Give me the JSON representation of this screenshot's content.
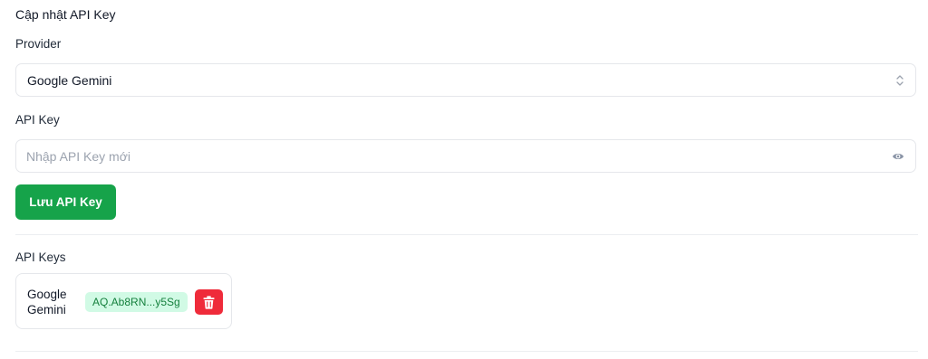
{
  "form": {
    "title": "Cập nhật API Key",
    "provider_label": "Provider",
    "provider_value": "Google Gemini",
    "api_key_label": "API Key",
    "api_key_value": "",
    "api_key_placeholder": "Nhập API Key mới",
    "save_label": "Lưu API Key",
    "icons": {
      "select": "chevron-up-down-icon",
      "toggle_visibility": "eye-icon"
    }
  },
  "keys_section": {
    "title": "API Keys",
    "items": [
      {
        "provider": "Google Gemini",
        "masked_key": "AQ.Ab8RN...y5Sg",
        "delete_icon": "trash-icon"
      }
    ]
  },
  "colors": {
    "primary_button": "#16a34a",
    "danger_button": "#ef2b3a",
    "key_badge_bg": "#d1fae5",
    "key_badge_text": "#15803d"
  }
}
